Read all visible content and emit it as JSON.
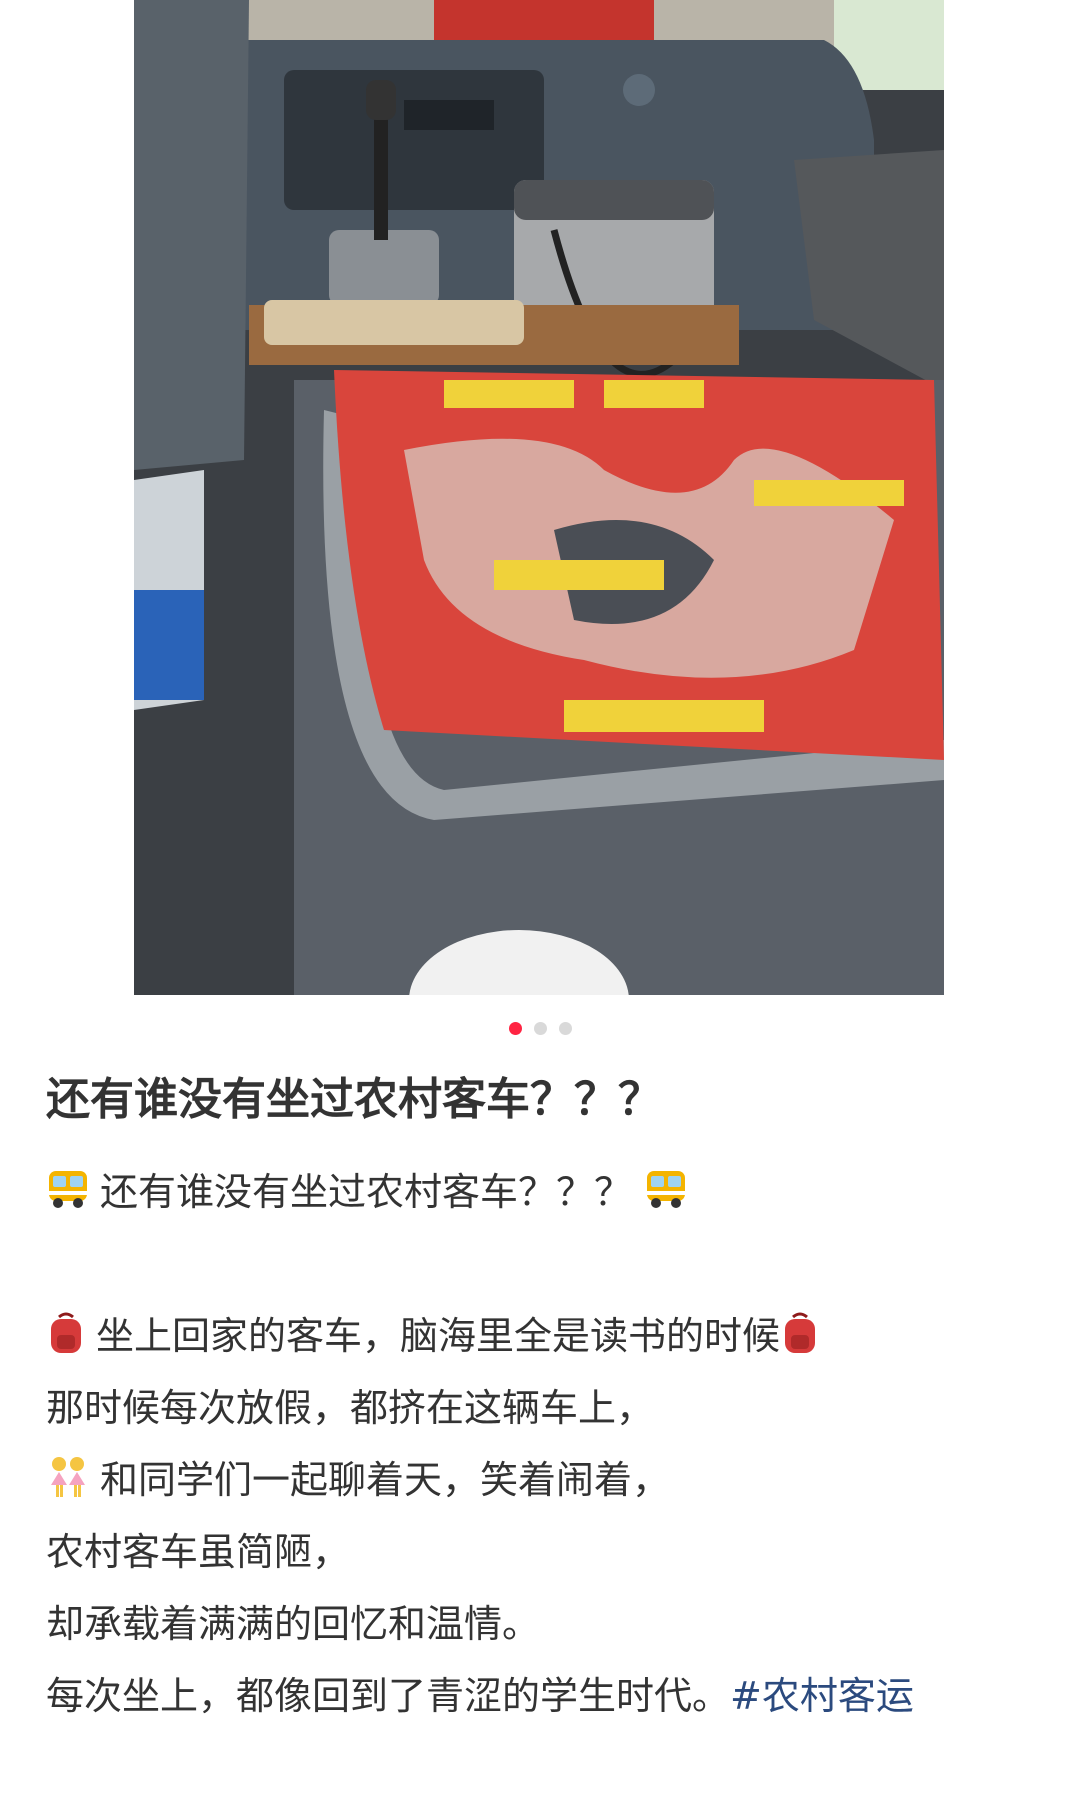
{
  "carousel": {
    "image_alt": "Interior of rural bus: driver console with worn red sign board",
    "total_images": 3,
    "active_index": 0
  },
  "post": {
    "title": "还有谁没有坐过农村客车？？？",
    "lines": [
      {
        "prefix_emoji": "bus-icon",
        "text": "还有谁没有坐过农村客车？？？",
        "suffix_emoji": "bus-icon"
      },
      {
        "text": ""
      },
      {
        "prefix_emoji": "backpack-icon",
        "text": "坐上回家的客车，脑海里全是读书的时候",
        "suffix_emoji": "backpack-icon"
      },
      {
        "text": "那时候每次放假，都挤在这辆车上，"
      },
      {
        "prefix_emoji": "two-women-icon",
        "text": "和同学们一起聊着天，笑着闹着，"
      },
      {
        "text": "农村客车虽简陋，"
      },
      {
        "text": "却承载着满满的回忆和温情。"
      },
      {
        "text": "每次坐上，都像回到了青涩的学生时代。",
        "hashtag": "#农村客运"
      }
    ]
  },
  "colors": {
    "accent": "#ff2442",
    "hashtag": "#2b4a7e",
    "text": "#333333"
  }
}
